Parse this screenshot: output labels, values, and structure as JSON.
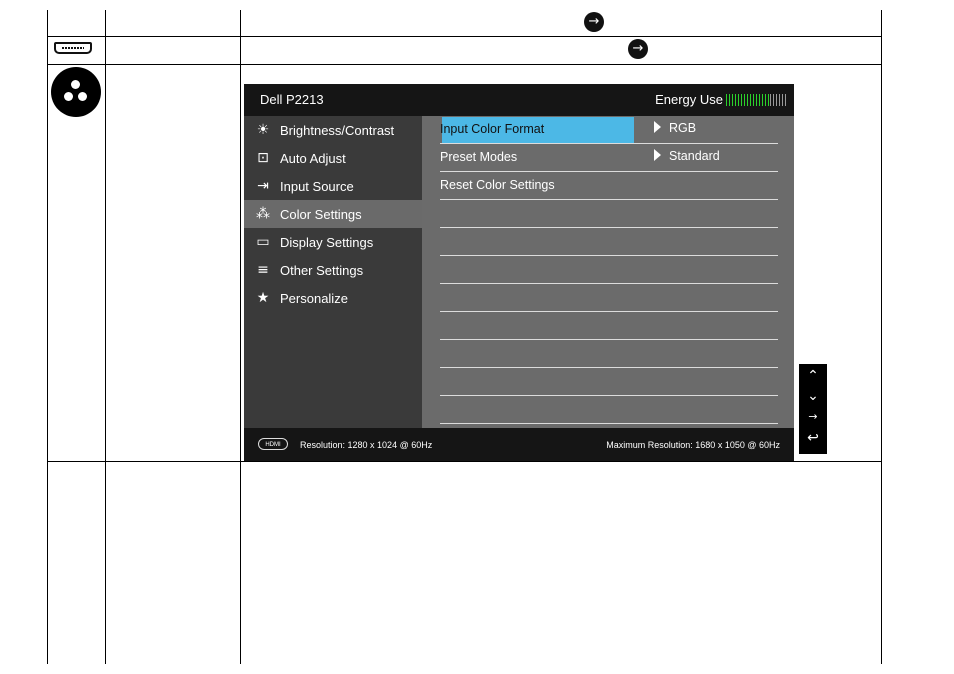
{
  "osd": {
    "model": "Dell P2213",
    "energy_label": "Energy Use",
    "menu": [
      {
        "label": "Brightness/Contrast",
        "icon": "brightness-icon"
      },
      {
        "label": "Auto Adjust",
        "icon": "auto-adjust-icon"
      },
      {
        "label": "Input Source",
        "icon": "input-source-icon"
      },
      {
        "label": "Color Settings",
        "icon": "color-settings-icon",
        "active": true
      },
      {
        "label": "Display Settings",
        "icon": "display-icon"
      },
      {
        "label": "Other Settings",
        "icon": "other-settings-icon"
      },
      {
        "label": "Personalize",
        "icon": "star-icon"
      }
    ],
    "settings": [
      {
        "label": "Input Color Format",
        "value": "RGB",
        "selected": true
      },
      {
        "label": "Preset Modes",
        "value": "Standard"
      },
      {
        "label": "Reset Color Settings",
        "value": ""
      }
    ],
    "hdmi_badge": "HDMI",
    "resolution_current": "Resolution: 1280 x 1024 @ 60Hz",
    "resolution_max": "Maximum Resolution: 1680 x 1050 @ 60Hz"
  },
  "nav_buttons": [
    "up-icon",
    "down-icon",
    "enter-icon",
    "back-icon"
  ],
  "colors": {
    "highlight": "#4cb8e6",
    "energy_green": "#2bd12b",
    "panel": "#6b6b6b",
    "menu_bg": "#3a3a3a"
  }
}
